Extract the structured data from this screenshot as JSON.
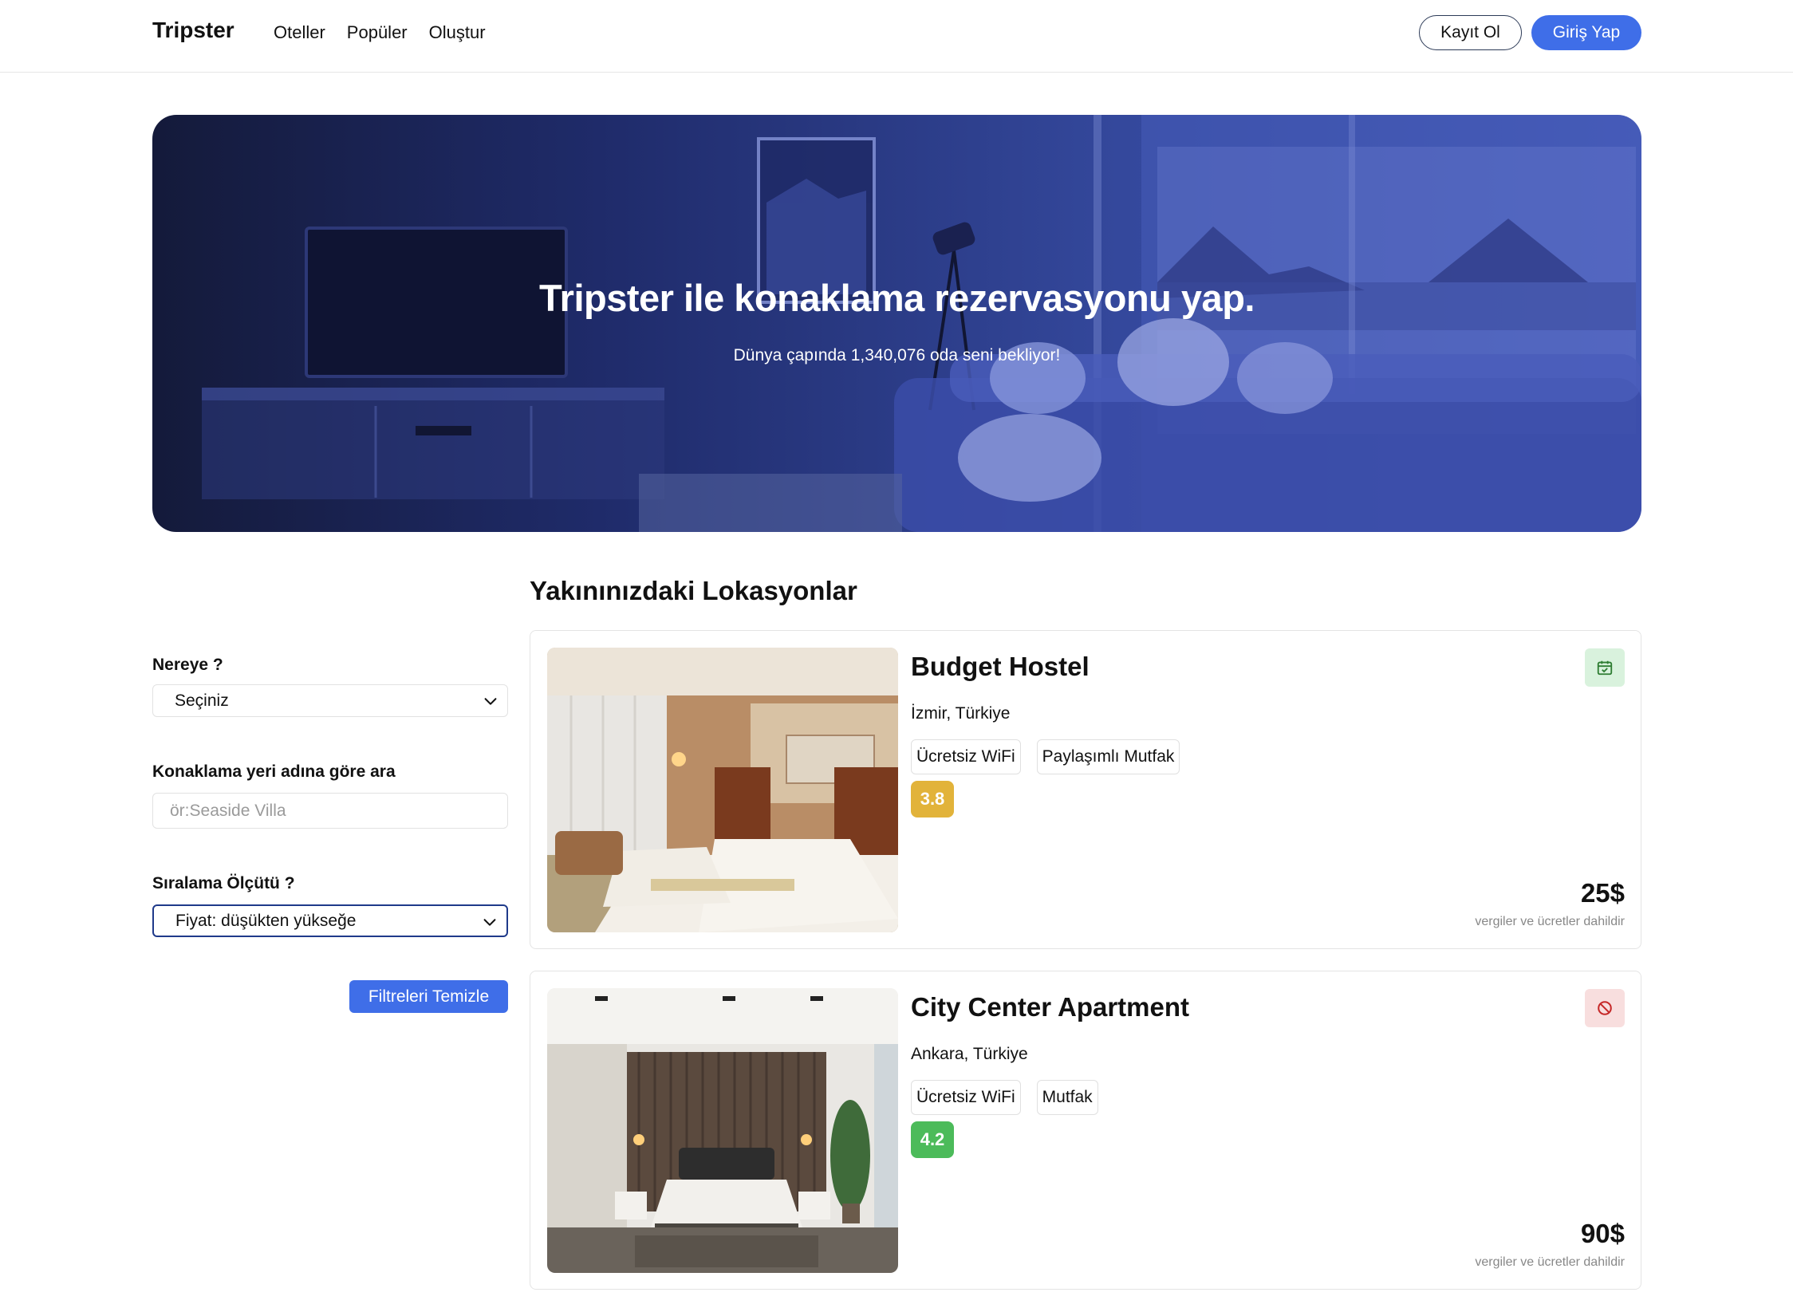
{
  "header": {
    "logo": "Tripster",
    "nav": [
      "Oteller",
      "Popüler",
      "Oluştur"
    ],
    "register_label": "Kayıt Ol",
    "login_label": "Giriş Yap"
  },
  "hero": {
    "title": "Tripster ile konaklama rezervasyonu yap.",
    "subtitle": "Dünya çapında 1,340,076 oda seni bekliyor!"
  },
  "filters": {
    "destination_label": "Nereye ?",
    "destination_value": "Seçiniz",
    "search_label": "Konaklama yeri adına göre ara",
    "search_placeholder": "ör:Seaside Villa",
    "sort_label": "Sıralama Ölçütü ?",
    "sort_value": "Fiyat: düşükten yükseğe",
    "clear_label": "Filtreleri Temizle"
  },
  "section_title": "Yakınınızdaki Lokasyonlar",
  "listings": [
    {
      "name": "Budget Hostel",
      "location": "İzmir, Türkiye",
      "tags": [
        "Ücretsiz WiFi",
        "Paylaşımlı Mutfak"
      ],
      "rating": "3.8",
      "rating_color": "#e2b33a",
      "status_icon": "calendar-check-icon",
      "status_bg": "#d9f2dd",
      "status_color": "#2e7d32",
      "price": "25$",
      "price_note": "vergiler ve ücretler dahildir"
    },
    {
      "name": "City Center Apartment",
      "location": "Ankara, Türkiye",
      "tags": [
        "Ücretsiz WiFi",
        "Mutfak"
      ],
      "rating": "4.2",
      "rating_color": "#4cbb5a",
      "status_icon": "no-entry-icon",
      "status_bg": "#f8dede",
      "status_color": "#c62828",
      "price": "90$",
      "price_note": "vergiler ve ücretler dahildir"
    }
  ]
}
